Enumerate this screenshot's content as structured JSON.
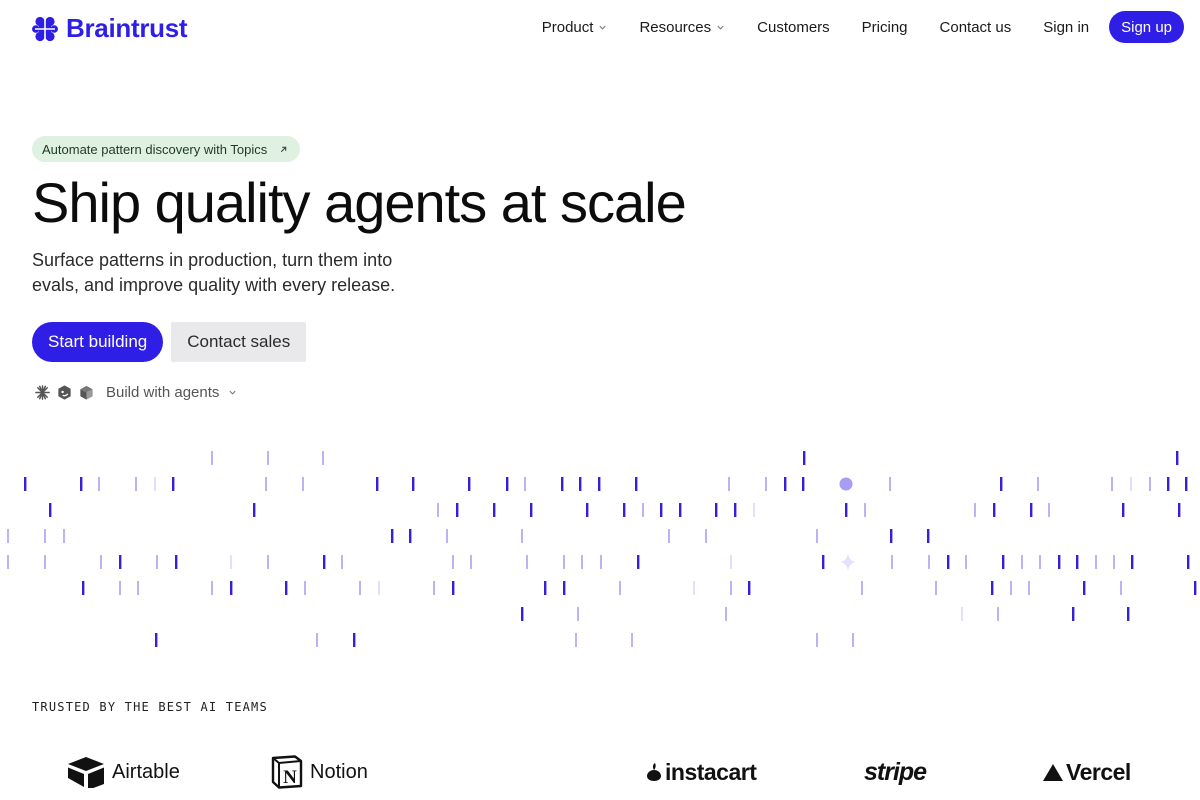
{
  "header": {
    "brand_name": "Braintrust",
    "brand_color": "#2f1fe6",
    "nav": [
      {
        "label": "Product",
        "dropdown": true
      },
      {
        "label": "Resources",
        "dropdown": true
      },
      {
        "label": "Customers",
        "dropdown": false
      },
      {
        "label": "Pricing",
        "dropdown": false
      },
      {
        "label": "Contact us",
        "dropdown": false
      }
    ],
    "sign_in_label": "Sign in",
    "sign_up_label": "Sign up"
  },
  "hero": {
    "announcement": "Automate pattern discovery with Topics",
    "title": "Ship quality agents at scale",
    "subtitle": "Surface patterns in production, turn them into evals, and improve quality with every release.",
    "primary_cta": "Start building",
    "secondary_cta": "Contact sales",
    "agents_label": "Build with agents",
    "agent_icons": [
      "claude-icon",
      "cursor-agent-icon",
      "cube-icon"
    ]
  },
  "colors": {
    "accent": "#2f1fe6",
    "pill_bg": "#dff2e1",
    "bar_strong": "#3320d8",
    "bar_light": "#b9b4f3"
  },
  "trusted": {
    "label": "TRUSTED BY THE BEST AI TEAMS",
    "logos": [
      {
        "name": "Airtable",
        "icon": "airtable-icon"
      },
      {
        "name": "Notion",
        "icon": "notion-icon"
      },
      {
        "name": "instacart",
        "icon": "instacart-icon"
      },
      {
        "name": "stripe",
        "icon": "stripe-icon"
      },
      {
        "name": "Vercel",
        "icon": "vercel-icon"
      }
    ]
  }
}
